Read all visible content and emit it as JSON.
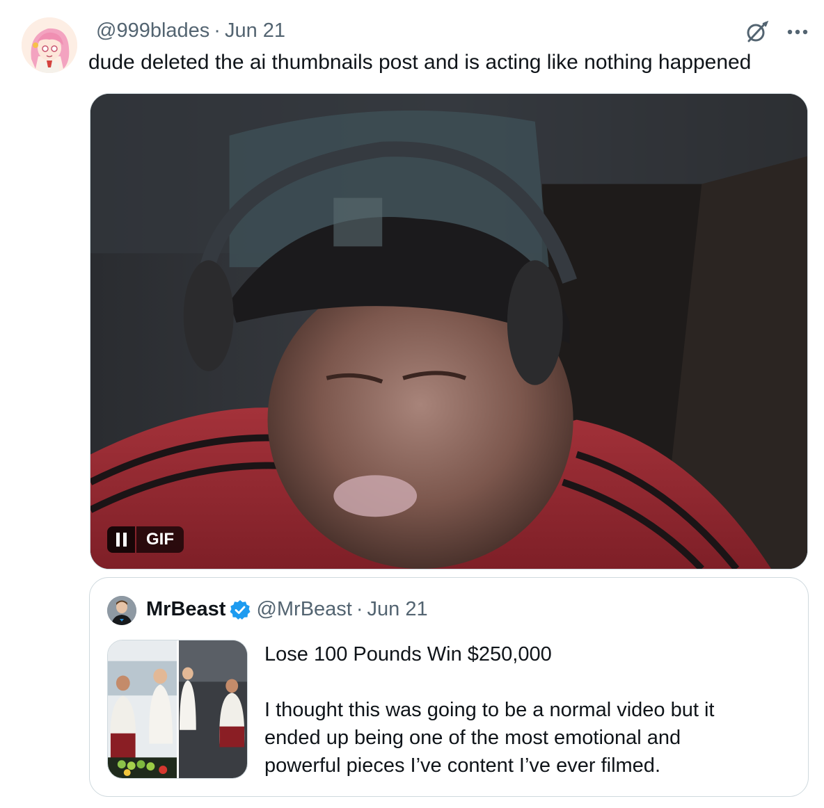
{
  "post": {
    "handle": "@999blades",
    "separator": "·",
    "date": "Jun 21",
    "text": "dude deleted the ai thumbnails post and is acting like nothing happened",
    "avatar_icon": "anime-girl-avatar",
    "grok_icon": "grok-icon",
    "more_icon": "more-icon"
  },
  "media": {
    "type": "gif",
    "gif_label": "GIF",
    "pause_icon": "pause-icon"
  },
  "quote": {
    "name": "MrBeast",
    "verified_color": "#1d9bf0",
    "handle": "@MrBeast",
    "separator": "·",
    "date": "Jun 21",
    "title_line": "Lose 100 Pounds Win $250,000",
    "body_lines": [
      "I thought this was going to be a normal video but it",
      "ended up being one of the most emotional and",
      "powerful pieces I’ve content I’ve ever filmed."
    ]
  },
  "colors": {
    "text_primary": "#0f1419",
    "text_secondary": "#536471",
    "border": "#cfd9de",
    "verified": "#1d9bf0"
  }
}
